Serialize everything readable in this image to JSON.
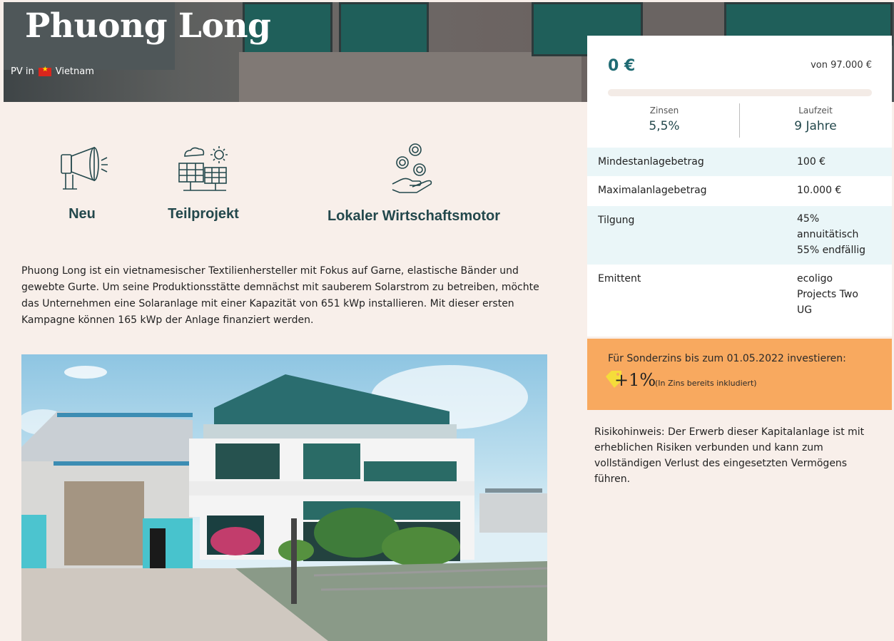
{
  "header": {
    "title": "Phuong Long",
    "subtitle_prefix": "PV in",
    "country": "Vietnam",
    "flag_icon": "vietnam-flag-icon"
  },
  "features": [
    {
      "label": "Neu",
      "icon": "megaphone-icon"
    },
    {
      "label": "Teilprojekt",
      "icon": "solar-panel-sun-icon"
    },
    {
      "label": "Lokaler Wirtschaftsmotor",
      "icon": "hand-coins-icon"
    }
  ],
  "description": "Phuong Long ist ein vietnamesischer Textilienhersteller mit Fokus auf Garne, elastische Bänder und gewebte Gurte. Um seine Produktionsstätte demnächst mit sauberem Solarstrom zu betreiben, möchte das Unternehmen eine Solaranlage mit einer Kapazität von 651 kWp installieren. Mit dieser ersten Kampagne können 165 kWp der Anlage finanziert werden.",
  "funding": {
    "amount": "0 €",
    "target": "von 97.000 €",
    "progress_fraction": 0.0
  },
  "stats": {
    "interest_label": "Zinsen",
    "interest_value": "5,5%",
    "term_label": "Laufzeit",
    "term_value": "9 Jahre"
  },
  "details": [
    {
      "key": "Mindestanlagebetrag",
      "value": "100 €"
    },
    {
      "key": "Maximalanlagebetrag",
      "value": "10.000 €"
    },
    {
      "key": "Tilgung",
      "value_lines": [
        "45%",
        "annuitätisch",
        "55% endfällig"
      ]
    },
    {
      "key": "Emittent",
      "value_lines": [
        "ecoligo",
        "Projects Two",
        "UG"
      ]
    }
  ],
  "bonus": {
    "text": "Für Sonderzins bis zum 01.05.2022 investieren:",
    "plus": "+1%",
    "note": "(In Zins bereits inkludiert)"
  },
  "risk_notice": "Risikohinweis: Der Erwerb dieser Kapitalanlage ist mit erheblichen Risiken verbunden und kann zum vollständigen Verlust des eingesetzten Vermögens führen.",
  "colors": {
    "accent": "#1f6b73",
    "bonus_bg": "#f8a95f",
    "row_alt_bg": "#eaf6f8",
    "page_bg": "#f8efea"
  }
}
